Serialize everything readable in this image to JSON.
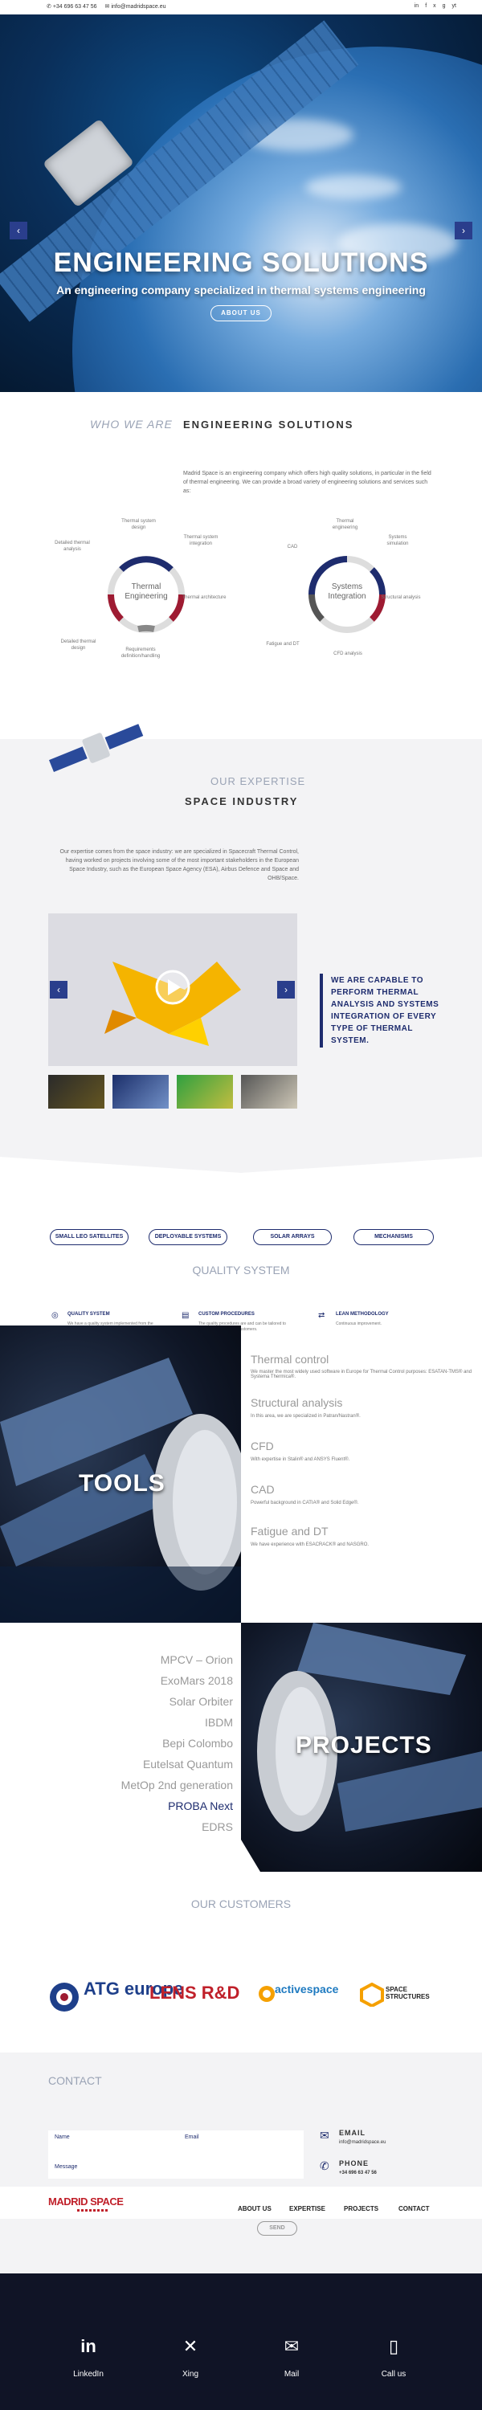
{
  "topbar": {
    "phone": "+34 696 63 47 56",
    "email": "info@madridspace.eu",
    "social": [
      "in",
      "f",
      "x",
      "g",
      "yt"
    ]
  },
  "hero": {
    "title": "ENGINEERING SOLUTIONS",
    "subtitle": "An engineering company specialized in thermal systems engineering",
    "button": "ABOUT US",
    "prev": "‹",
    "next": "›"
  },
  "who": {
    "label": "WHO WE ARE",
    "title": "ENGINEERING SOLUTIONS",
    "text": "Madrid Space is an engineering company which offers high quality solutions, in particular in the field of thermal engineering. We can provide a broad variety of engineering solutions and services such as:",
    "ring1": {
      "center": "Thermal Engineering",
      "labels": [
        "Thermal system design",
        "Thermal system integration",
        "Detailed thermal analysis",
        "Thermal architecture",
        "Requirements definition/handling",
        "Detailed thermal design"
      ]
    },
    "ring2": {
      "center": "Systems Integration",
      "labels": [
        "Thermal engineering",
        "Systems simulation",
        "CAD",
        "Structural analysis",
        "Fatigue and DT",
        "CFD analysis"
      ]
    }
  },
  "expertise": {
    "label": "OUR EXPERTISE",
    "title": "SPACE INDUSTRY",
    "text": "Our expertise comes from the space industry: we are specialized in Spacecraft Thermal Control, having worked on projects involving some of the most important stakeholders in the European Space Industry, such as the European Space Agency (ESA), Airbus Defence and Space and OHB/Space.",
    "callout": "WE ARE CAPABLE TO PERFORM THERMAL ANALYSIS AND SYSTEMS INTEGRATION OF EVERY TYPE OF THERMAL SYSTEM."
  },
  "quality": {
    "pills": [
      "SMALL LEO SATELLITES",
      "DEPLOYABLE SYSTEMS",
      "SOLAR ARRAYS",
      "MECHANISMS"
    ],
    "title": "QUALITY SYSTEM",
    "items": [
      {
        "title": "QUALITY SYSTEM",
        "text": "We have a quality system implemented from the very beginning of our activities."
      },
      {
        "title": "CUSTOM PROCEDURES",
        "text": "The quality procedures are and can be tailored to the procedures of our customers."
      },
      {
        "title": "LEAN METHODOLOGY",
        "text": "Continuous improvement."
      }
    ]
  },
  "tools": {
    "heading": "TOOLS",
    "items": [
      {
        "title": "Thermal control",
        "text": "We master the most widely used software in Europe for Thermal Control purposes: ESATAN-TMS® and Systema Thermica®."
      },
      {
        "title": "Structural analysis",
        "text": "In this area, we are specialized in Patran/Nastran®."
      },
      {
        "title": "CFD",
        "text": "With expertise in Stalin® and ANSYS Fluent®."
      },
      {
        "title": "CAD",
        "text": "Powerful background in CATIA® and Solid Edge®."
      },
      {
        "title": "Fatigue and DT",
        "text": "We have experience with ESACRACK® and NASGRO."
      }
    ]
  },
  "projects": {
    "heading": "PROJECTS",
    "items": [
      "MPCV – Orion",
      "ExoMars 2018",
      "Solar Orbiter",
      "IBDM",
      "Bepi Colombo",
      "Eutelsat Quantum",
      "MetOp 2nd generation",
      "PROBA Next",
      "EDRS"
    ]
  },
  "customers": {
    "title": "OUR CUSTOMERS",
    "logos": [
      "ATG europe",
      "LENS R&D",
      "activespace",
      "SPACE STRUCTURES"
    ]
  },
  "contact": {
    "title": "CONTACT",
    "fields": {
      "name": "Name",
      "email": "Email",
      "message": "Message"
    },
    "email_label": "EMAIL",
    "email_value": "info@madridspace.eu",
    "phone_label": "PHONE",
    "phone_value": "+34 696 63 47 56",
    "send": "SEND"
  },
  "nav": {
    "logo": "MADRID SPACE",
    "items": [
      "ABOUT US",
      "EXPERTISE",
      "PROJECTS",
      "CONTACT"
    ]
  },
  "footer": {
    "items": [
      {
        "icon": "in",
        "label": "LinkedIn"
      },
      {
        "icon": "✕",
        "label": "Xing"
      },
      {
        "icon": "✉",
        "label": "Mail"
      },
      {
        "icon": "▯",
        "label": "Call us"
      }
    ]
  },
  "colors": {
    "navy": "#1e2c6e",
    "red": "#9e1b32",
    "grey": "#9b9b9b"
  }
}
